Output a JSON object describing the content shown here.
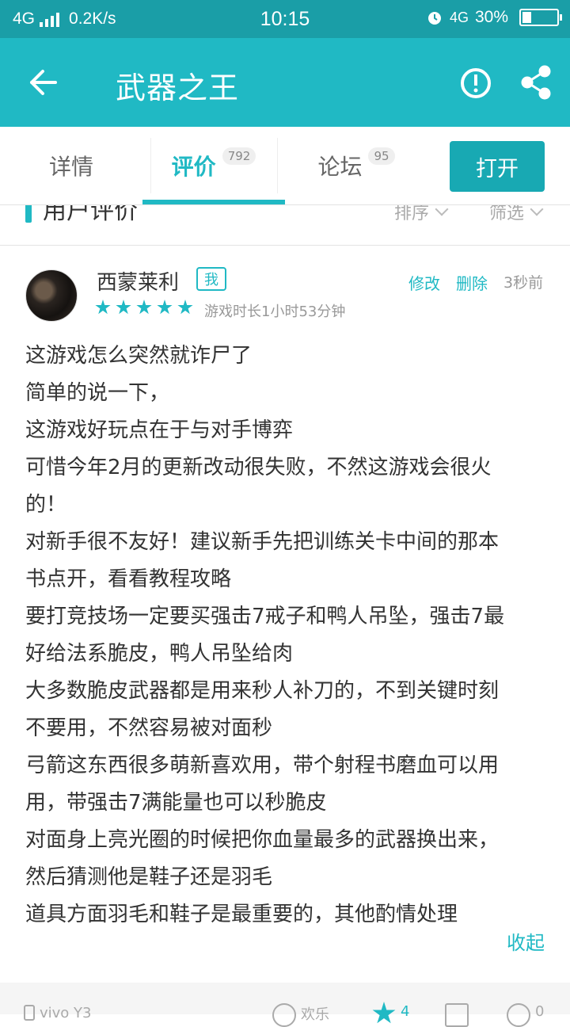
{
  "status_bar": {
    "network": "4G",
    "speed": "0.2K/s",
    "time": "10:15",
    "net2": "4G",
    "battery": "30%"
  },
  "app_bar": {
    "title": "武器之王",
    "back_icon": "arrow-left-icon",
    "report_icon": "exclamation-circle-icon",
    "share_icon": "share-icon"
  },
  "tabs": [
    {
      "label": "详情",
      "count": ""
    },
    {
      "label": "评价",
      "count": "792"
    },
    {
      "label": "论坛",
      "count": "95"
    }
  ],
  "open_button": "打开",
  "section": {
    "title": "用户评价",
    "sort": "排序",
    "filter": "筛选"
  },
  "review": {
    "username": "西蒙莱利",
    "me_badge": "我",
    "edit": "修改",
    "delete": "删除",
    "time": "3秒前",
    "rating": 5,
    "playtime": "游戏时长1小时53分钟",
    "lines": [
      "这游戏怎么突然就诈尸了",
      "简单的说一下，",
      "这游戏好玩点在于与对手博弈",
      "可惜今年2月的更新改动很失败，不然这游戏会很火",
      "的！",
      "对新手很不友好！建议新手先把训练关卡中间的那本",
      "书点开，看看教程攻略",
      "要打竞技场一定要买强击7戒子和鸭人吊坠，强击7最",
      "好给法系脆皮，鸭人吊坠给肉",
      "大多数脆皮武器都是用来秒人补刀的，不到关键时刻",
      "不要用，不然容易被对面秒",
      "弓箭这东西很多萌新喜欢用，带个射程书磨血可以用",
      "用，带强击7满能量也可以秒脆皮",
      "对面身上亮光圈的时候把你血量最多的武器换出来，",
      "然后猜测他是鞋子还是羽毛",
      "道具方面羽毛和鞋子是最重要的，其他酌情处理"
    ],
    "collapse": "收起"
  },
  "footer": {
    "device": "vivo Y3",
    "happy": "欢乐",
    "likes": "4",
    "comments": "0"
  },
  "colors": {
    "accent": "#20b9c4",
    "status_bar": "#1a9ea7"
  }
}
